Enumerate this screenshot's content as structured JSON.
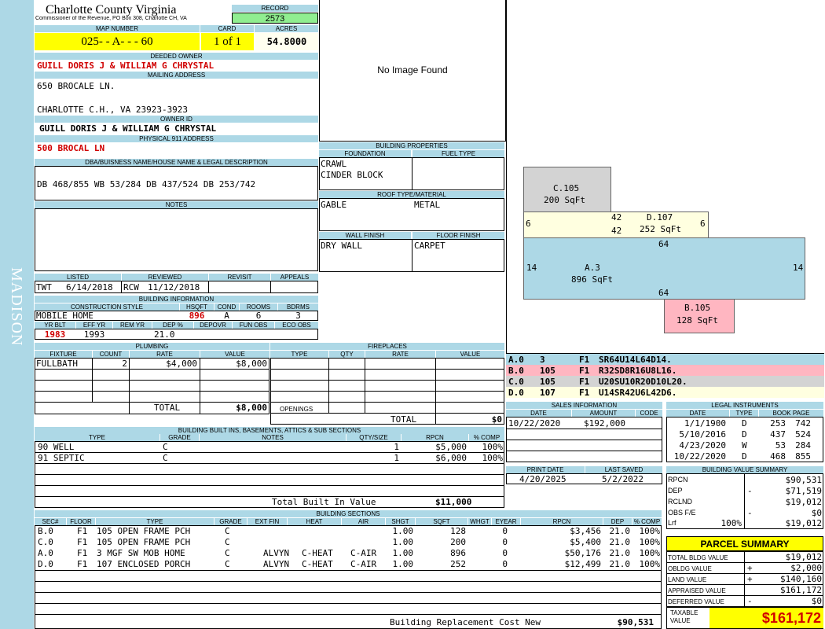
{
  "sidebar": {
    "district": "MADISON"
  },
  "header": {
    "county": "Charlotte County Virginia",
    "commissioner": "Commissioner of the Revenue, PO Box 308, Charlotte CH, VA",
    "record_label": "RECORD",
    "record": "2573",
    "map_number_label": "MAP NUMBER",
    "map_number": "025- - A- - - 60",
    "card_label": "CARD",
    "card": "1 of 1",
    "acres_label": "ACRES",
    "acres": "54.8000"
  },
  "owner": {
    "deeded_owner_label": "DEEDED OWNER",
    "deeded_owner": "GUILL DORIS J & WILLIAM G CHRYSTAL",
    "mailing_address_label": "MAILING ADDRESS",
    "address_line1": "650 BROCALE LN.",
    "address_line2": "CHARLOTTE C.H., VA 23923-3923",
    "owner_id_label": "OWNER ID",
    "owner_id": "GUILL DORIS J & WILLIAM G CHRYSTAL",
    "physical_address_label": "PHYSICAL 911 ADDRESS",
    "physical_address": "500 BROCAL LN",
    "legal_label": "DBA/BUISNESS NAME/HOUSE NAME & LEGAL DESCRIPTION",
    "legal": "DB 468/855 WB 53/284 DB 437/524 DB 253/742",
    "notes_label": "NOTES"
  },
  "image": {
    "placeholder": "No Image Found"
  },
  "building_properties": {
    "title": "BUILDING PROPERTIES",
    "foundation_label": "FOUNDATION",
    "fuel_label": "FUEL TYPE",
    "foundation1": "CRAWL",
    "foundation2": "CINDER BLOCK",
    "roof_label": "ROOF TYPE/MATERIAL",
    "roof_type": "GABLE",
    "roof_material": "METAL",
    "wall_label": "WALL FINISH",
    "floor_label": "FLOOR FINISH",
    "wall": "DRY WALL",
    "floor": "CARPET"
  },
  "review": {
    "listed_label": "LISTED",
    "reviewed_label": "REVIEWED",
    "revisit_label": "REVISIT",
    "appeals_label": "APPEALS",
    "listed_by": "TWT",
    "listed_date": "6/14/2018",
    "reviewed_by": "RCW",
    "reviewed_date": "11/12/2018"
  },
  "building_info": {
    "title": "BUILDING INFORMATION",
    "style_label": "CONSTRUCTION STYLE",
    "hsqft_label": "HSQFT",
    "cond_label": "COND",
    "rooms_label": "ROOMS",
    "bdrms_label": "BDRMS",
    "style": "MOBILE HOME",
    "hsqft": "896",
    "cond": "A",
    "rooms": "6",
    "bdrms": "3",
    "yrblt_label": "YR BLT",
    "effyr_label": "EFF YR",
    "remyr_label": "REM YR",
    "dep_label": "DEP %",
    "depovr_label": "DEPOVR",
    "funobs_label": "FUN OBS",
    "ecoobs_label": "ECO OBS",
    "yrblt": "1983",
    "effyr": "1993",
    "dep": "21.0"
  },
  "plumbing": {
    "title": "PLUMBING",
    "fixture_label": "FIXTURE",
    "count_label": "COUNT",
    "rate_label": "RATE",
    "value_label": "VALUE",
    "fixture": "FULLBATH",
    "count": "2",
    "rate": "$4,000",
    "value": "$8,000",
    "total_label": "TOTAL",
    "total": "$8,000"
  },
  "fireplaces": {
    "title": "FIREPLACES",
    "type_label": "TYPE",
    "qty_label": "QTY",
    "rate_label": "RATE",
    "value_label": "VALUE",
    "openings_label": "OPENINGS",
    "total_label": "TOTAL",
    "total": "$0"
  },
  "builtins": {
    "title": "BUILDING BUILT INS, BASEMENTS, ATTICS & SUB SECTIONS",
    "type_label": "TYPE",
    "grade_label": "GRADE",
    "notes_label": "NOTES",
    "qty_label": "QTY/SIZE",
    "rpcn_label": "RPCN",
    "comp_label": "% COMP",
    "rows": [
      {
        "type": "90 WELL",
        "grade": "C",
        "qty": "1",
        "rpcn": "$5,000",
        "comp": "100%"
      },
      {
        "type": "91 SEPTIC",
        "grade": "C",
        "qty": "1",
        "rpcn": "$6,000",
        "comp": "100%"
      }
    ],
    "total_label": "Total Built In Value",
    "total": "$11,000"
  },
  "sketch": {
    "c_label": "C.105",
    "c_area": "200 SqFt",
    "d_label": "D.107",
    "d_area": "252 SqFt",
    "a_label": "A.3",
    "a_area": "896 SqFt",
    "b_label": "B.105",
    "b_area": "128 SqFt",
    "d_left": "6",
    "d_right": "6",
    "d_top": "42",
    "d_bottom": "42",
    "a_top": "64",
    "a_bottom": "64",
    "a_left": "14",
    "a_right": "14"
  },
  "sketch_codes": [
    {
      "id": "A.0",
      "n": "3",
      "f": "F1",
      "code": "SR64U14L64D14."
    },
    {
      "id": "B.0",
      "n": "105",
      "f": "F1",
      "code": "R32SD8R16U8L16."
    },
    {
      "id": "C.0",
      "n": "105",
      "f": "F1",
      "code": "U20SU10R20D10L20."
    },
    {
      "id": "D.0",
      "n": "107",
      "f": "F1",
      "code": "U14SR42U6L42D6."
    }
  ],
  "sales": {
    "title": "SALES INFORMATION",
    "date_label": "DATE",
    "amount_label": "AMOUNT",
    "code_label": "CODE",
    "date": "10/22/2020",
    "amount": "$192,000"
  },
  "legal_instruments": {
    "title": "LEGAL INSTRUMENTS",
    "date_label": "DATE",
    "type_label": "TYPE",
    "book_label": "BOOK PAGE",
    "rows": [
      {
        "date": "1/1/1900",
        "type": "D",
        "book": "253",
        "page": "742"
      },
      {
        "date": "5/10/2016",
        "type": "D",
        "book": "437",
        "page": "524"
      },
      {
        "date": "4/23/2020",
        "type": "W",
        "book": "53",
        "page": "284"
      },
      {
        "date": "10/22/2020",
        "type": "D",
        "book": "468",
        "page": "855"
      }
    ]
  },
  "print": {
    "print_date_label": "PRINT DATE",
    "last_saved_label": "LAST SAVED",
    "print_date": "4/20/2025",
    "last_saved": "5/2/2022"
  },
  "value_summary": {
    "title": "BUILDING VALUE SUMMARY",
    "rows": [
      {
        "label": "RPCN",
        "sign": "",
        "value": "$90,531"
      },
      {
        "label": "DEP",
        "sign": "-",
        "value": "$71,519"
      },
      {
        "label": "RCLND",
        "sign": "",
        "value": "$19,012"
      },
      {
        "label": "OBS F/E",
        "sign": "-",
        "value": "$0"
      },
      {
        "label": "Lrf",
        "pct": "100%",
        "sign": "",
        "value": "$19,012"
      }
    ]
  },
  "sections": {
    "title": "BUILDING SECTIONS",
    "labels": {
      "sec": "SEC#",
      "floor": "FLOOR",
      "type": "TYPE",
      "grade": "GRADE",
      "extfin": "EXT FIN",
      "heat": "HEAT",
      "air": "AIR",
      "shgt": "SHGT",
      "sqft": "SQFT",
      "whgt": "WHGT",
      "eyear": "EYEAR",
      "rpcn": "RPCN",
      "dep": "DEP",
      "comp": "% COMP"
    },
    "rows": [
      {
        "sec": "B.0",
        "floor": "F1",
        "type": "105 OPEN FRAME PCH",
        "grade": "C",
        "extfin": "",
        "heat": "",
        "air": "",
        "shgt": "1.00",
        "sqft": "128",
        "whgt": "0",
        "rpcn": "$3,456",
        "dep": "21.0",
        "comp": "100%"
      },
      {
        "sec": "C.0",
        "floor": "F1",
        "type": "105 OPEN FRAME PCH",
        "grade": "C",
        "extfin": "",
        "heat": "",
        "air": "",
        "shgt": "1.00",
        "sqft": "200",
        "whgt": "0",
        "rpcn": "$5,400",
        "dep": "21.0",
        "comp": "100%"
      },
      {
        "sec": "A.0",
        "floor": "F1",
        "type": "3 MGF SW MOB HOME",
        "grade": "C",
        "extfin": "ALVYN",
        "heat": "C-HEAT",
        "air": "C-AIR",
        "shgt": "1.00",
        "sqft": "896",
        "whgt": "0",
        "rpcn": "$50,176",
        "dep": "21.0",
        "comp": "100%"
      },
      {
        "sec": "D.0",
        "floor": "F1",
        "type": "107 ENCLOSED PORCH",
        "grade": "C",
        "extfin": "ALVYN",
        "heat": "C-HEAT",
        "air": "C-AIR",
        "shgt": "1.00",
        "sqft": "252",
        "whgt": "0",
        "rpcn": "$12,499",
        "dep": "21.0",
        "comp": "100%"
      }
    ],
    "total_label": "Building Replacement Cost New",
    "total": "$90,531"
  },
  "parcel": {
    "title": "PARCEL SUMMARY",
    "rows": [
      {
        "label": "TOTAL BLDG VALUE",
        "sign": "",
        "value": "$19,012"
      },
      {
        "label": "OBLDG VALUE",
        "sign": "+",
        "value": "$2,000"
      },
      {
        "label": "LAND VALUE",
        "sign": "+",
        "value": "$140,160"
      },
      {
        "label": "APPRAISED VALUE",
        "sign": "",
        "value": "$161,172"
      },
      {
        "label": "DEFERRED VALUE",
        "sign": "-",
        "value": "$0"
      }
    ],
    "taxable_label": "TAXABLE VALUE",
    "taxable": "$161,172"
  }
}
